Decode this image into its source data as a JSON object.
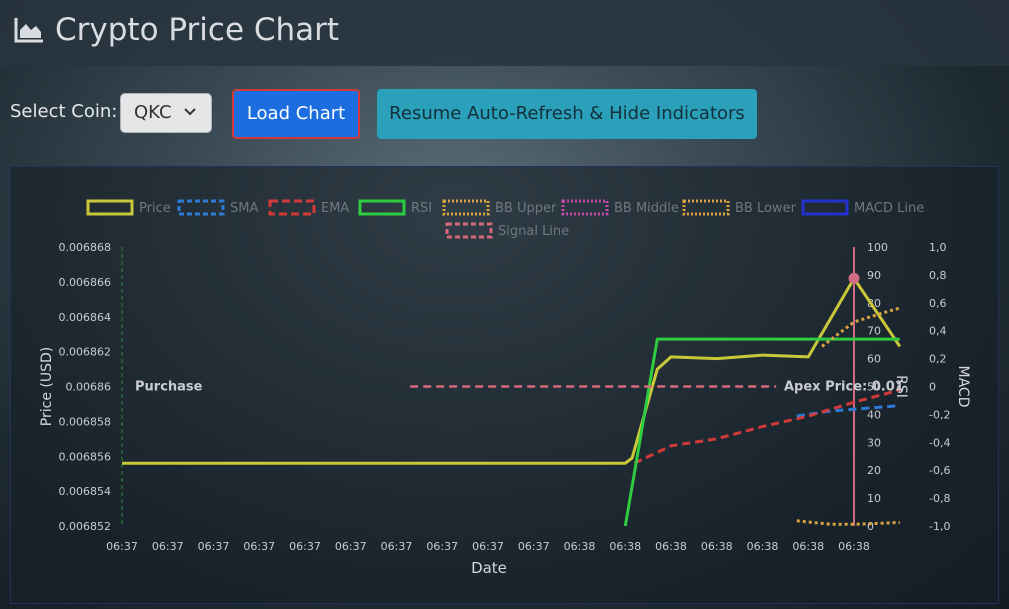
{
  "header": {
    "title": "Crypto Price Chart",
    "icon": "area-chart-icon"
  },
  "controls": {
    "select_label": "Select Coin:",
    "coin": "QKC",
    "load_button": "Load Chart",
    "resume_button": "Resume Auto-Refresh & Hide Indicators"
  },
  "colors": {
    "price": "#c9c83a",
    "sma": "#2e7bd6",
    "ema": "#d23a3a",
    "rsi": "#2ecc40",
    "bb_upper": "#d9a441",
    "bb_middle": "#c04ca8",
    "bb_lower": "#d9a441",
    "macd": "#2233cc",
    "signal": "#d8687a",
    "apex": "#cf6b85"
  },
  "chart_data": {
    "type": "line",
    "xlabel": "Date",
    "x": [
      "06:37",
      "06:37",
      "06:37",
      "06:37",
      "06:37",
      "06:37",
      "06:37",
      "06:37",
      "06:37",
      "06:37",
      "06:38",
      "06:38",
      "06:38",
      "06:38",
      "06:38",
      "06:38",
      "06:38"
    ],
    "yaxes": {
      "price": {
        "label": "Price (USD)",
        "min": 0.006852,
        "max": 0.006868,
        "ticks": [
          "0.006868",
          "0.006866",
          "0.006864",
          "0.006862",
          "0.00686",
          "0.006858",
          "0.006856",
          "0.006854",
          "0.006852"
        ]
      },
      "rsi": {
        "label": "RSI",
        "min": 0,
        "max": 100,
        "ticks": [
          "100",
          "90",
          "80",
          "70",
          "60",
          "50",
          "40",
          "30",
          "20",
          "10",
          "0"
        ]
      },
      "macd": {
        "label": "MACD",
        "min": -1.0,
        "max": 1.0,
        "ticks": [
          "1,0",
          "0,8",
          "0,6",
          "0,4",
          "0,2",
          "0",
          "-0,2",
          "-0,4",
          "-0,6",
          "-0,8",
          "-1,0"
        ]
      }
    },
    "legend": [
      "Price",
      "SMA",
      "EMA",
      "RSI",
      "BB Upper",
      "BB Middle",
      "BB Lower",
      "MACD Line",
      "Signal Line"
    ],
    "legend_position": "top",
    "series": [
      {
        "name": "Price",
        "axis": "price",
        "style": "solid",
        "points": [
          [
            0,
            0.0068556
          ],
          [
            1,
            0.0068556
          ],
          [
            2,
            0.0068556
          ],
          [
            3,
            0.0068556
          ],
          [
            4,
            0.0068556
          ],
          [
            5,
            0.0068556
          ],
          [
            6,
            0.0068556
          ],
          [
            7,
            0.0068556
          ],
          [
            8,
            0.0068556
          ],
          [
            9,
            0.0068556
          ],
          [
            10,
            0.0068556
          ],
          [
            11,
            0.0068556
          ],
          [
            11.15,
            0.0068559
          ],
          [
            11.7,
            0.006861
          ],
          [
            12,
            0.0068617
          ],
          [
            13,
            0.0068616
          ],
          [
            14,
            0.0068618
          ],
          [
            15,
            0.0068617
          ],
          [
            16,
            0.0068662
          ],
          [
            17,
            0.0068623
          ]
        ]
      },
      {
        "name": "SMA",
        "axis": "price",
        "style": "dashed",
        "points": [
          [
            14.75,
            0.0068583
          ],
          [
            15.5,
            0.0068586
          ],
          [
            16,
            0.0068587
          ],
          [
            17,
            0.0068589
          ]
        ]
      },
      {
        "name": "EMA",
        "axis": "price",
        "style": "dashed",
        "points": [
          [
            11.2,
            0.0068556
          ],
          [
            12,
            0.0068566
          ],
          [
            13,
            0.006857
          ],
          [
            14,
            0.0068577
          ],
          [
            15,
            0.0068583
          ],
          [
            16,
            0.0068591
          ],
          [
            17,
            0.0068598
          ]
        ]
      },
      {
        "name": "RSI",
        "axis": "rsi",
        "style": "solid",
        "points": [
          [
            11,
            0
          ],
          [
            11.7,
            67
          ],
          [
            13,
            67
          ],
          [
            14,
            67
          ],
          [
            15,
            67
          ],
          [
            16,
            67
          ],
          [
            17,
            67
          ]
        ]
      },
      {
        "name": "BB Upper",
        "axis": "price",
        "style": "dotted",
        "points": [
          [
            15.3,
            0.0068623
          ],
          [
            16,
            0.0068637
          ],
          [
            16.6,
            0.0068642
          ],
          [
            17,
            0.0068645
          ]
        ]
      },
      {
        "name": "BB Lower",
        "axis": "price",
        "style": "dotted",
        "points": [
          [
            14.75,
            0.0068523
          ],
          [
            15.5,
            0.0068521
          ],
          [
            16,
            0.0068521
          ],
          [
            17,
            0.0068522
          ]
        ]
      },
      {
        "name": "Signal Line",
        "axis": "macd",
        "style": "dashed",
        "points": [
          [
            6.3,
            0
          ],
          [
            14.3,
            0
          ]
        ]
      }
    ],
    "annotations": [
      {
        "text": "Purchase",
        "x": 0,
        "type": "vertical-line",
        "color": "#2e8b3a"
      },
      {
        "text": "Apex Price: 0.01",
        "x": 16,
        "price": 0.0068662,
        "type": "vertical-line-point"
      }
    ]
  }
}
